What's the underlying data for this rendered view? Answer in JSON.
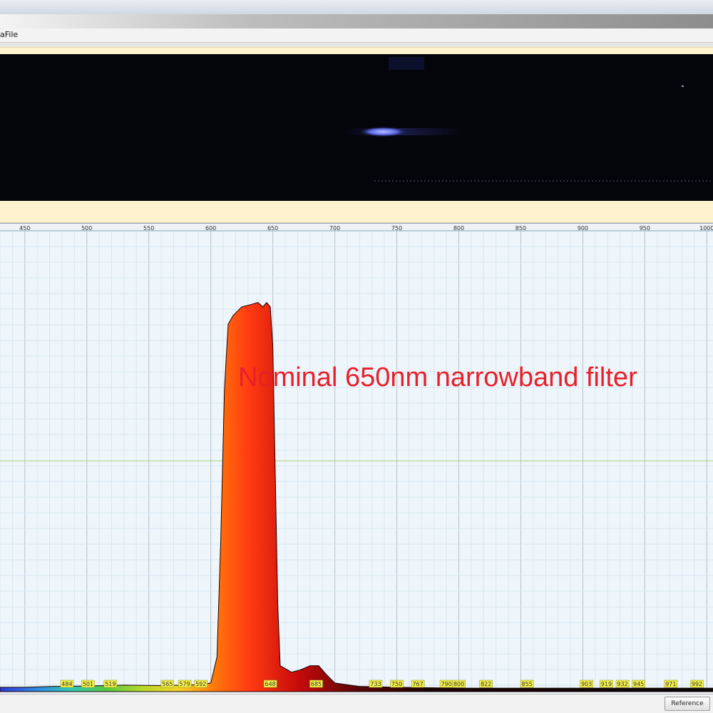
{
  "menubar": {
    "file_label": "aFile"
  },
  "chart_data": {
    "type": "area",
    "title": "",
    "annotation": "Nominal 650nm narrowband filter",
    "xlabel": "",
    "ylabel": "",
    "xlim": [
      430,
      1005
    ],
    "ylim": [
      0,
      1
    ],
    "grid": true,
    "x_ticks": [
      450,
      500,
      550,
      600,
      650,
      700,
      750,
      800,
      850,
      900,
      950,
      1000
    ],
    "series": [
      {
        "x": [
          430,
          450,
          470,
          500,
          530,
          560,
          590,
          600,
          605,
          608,
          611,
          614,
          618,
          625,
          632,
          638,
          642,
          645,
          648,
          650,
          652,
          654,
          656,
          665,
          672,
          680,
          687,
          693,
          700,
          720,
          750,
          800,
          850,
          900,
          950,
          1005
        ],
        "y": [
          0.01,
          0.01,
          0.012,
          0.013,
          0.015,
          0.014,
          0.016,
          0.02,
          0.08,
          0.35,
          0.7,
          0.85,
          0.87,
          0.89,
          0.895,
          0.9,
          0.89,
          0.9,
          0.89,
          0.8,
          0.5,
          0.2,
          0.06,
          0.045,
          0.05,
          0.06,
          0.06,
          0.04,
          0.02,
          0.012,
          0.01,
          0.008,
          0.008,
          0.008,
          0.008,
          0.008
        ]
      }
    ],
    "peak_markers": [
      484,
      501,
      519,
      565,
      579,
      592,
      648,
      685,
      733,
      750,
      767,
      790,
      800,
      822,
      855,
      903,
      919,
      932,
      945,
      971,
      992
    ]
  },
  "colors": {
    "annotation": "#e8202a",
    "grid_major": "#b8c4cc",
    "grid_minor": "#d8e6ef",
    "reference_line": "#a8d36a",
    "marker_fill": "#f4f04a"
  },
  "statusbar": {
    "reference_label": "Reference"
  }
}
